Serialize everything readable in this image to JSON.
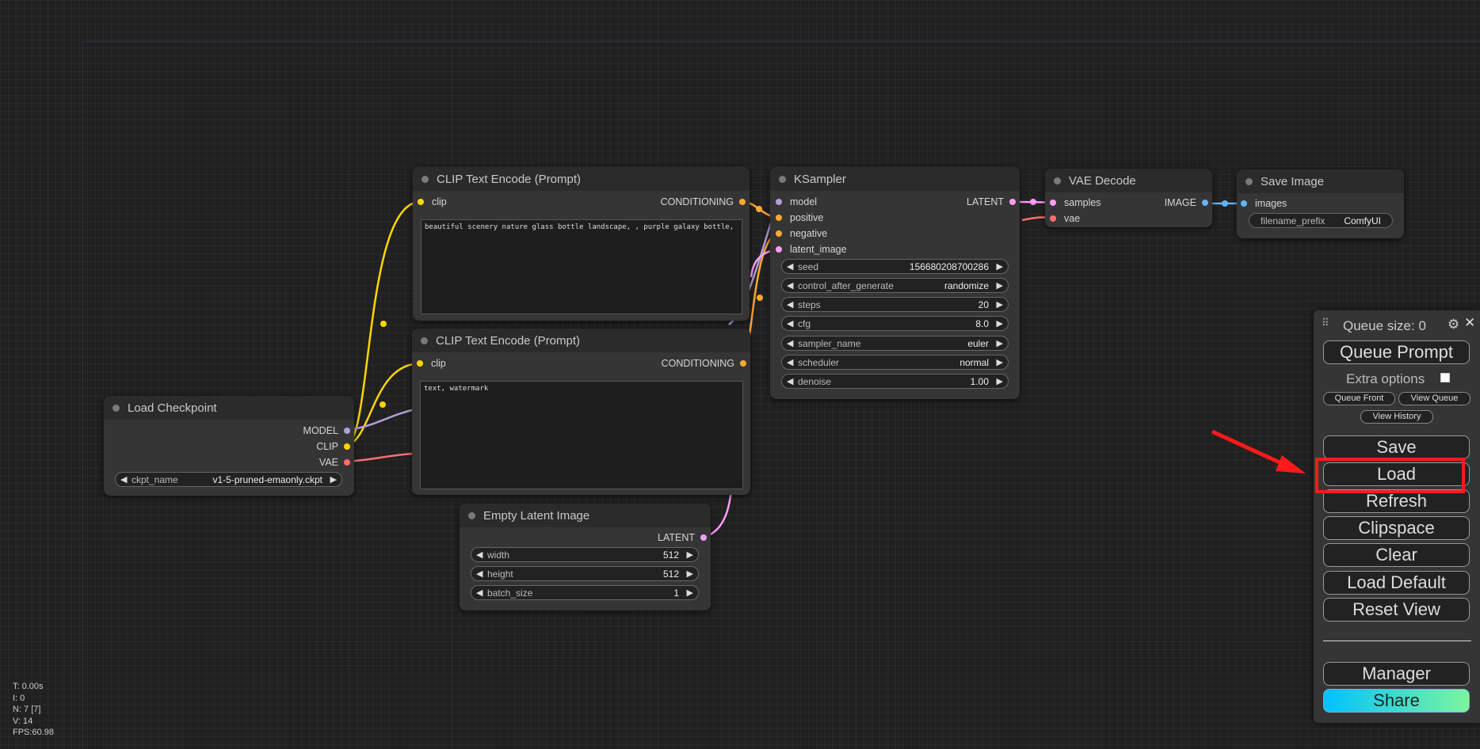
{
  "colors": {
    "model": "#b39ddb",
    "clip": "#ffd500",
    "vae": "#ff6e6e",
    "conditioning": "#ffa931",
    "latent": "#ff9cf9",
    "image": "#64b5f6",
    "annotation": "#ff1a1a"
  },
  "nodes": {
    "clip_pos": {
      "title": "CLIP Text Encode (Prompt)",
      "input_clip": "clip",
      "output": "CONDITIONING",
      "text": "beautiful scenery nature glass bottle landscape, , purple galaxy bottle,"
    },
    "clip_neg": {
      "title": "CLIP Text Encode (Prompt)",
      "input_clip": "clip",
      "output": "CONDITIONING",
      "text": "text, watermark"
    },
    "ksampler": {
      "title": "KSampler",
      "inputs": [
        "model",
        "positive",
        "negative",
        "latent_image"
      ],
      "output": "LATENT",
      "widgets": [
        {
          "name": "seed",
          "value": "156680208700286"
        },
        {
          "name": "control_after_generate",
          "value": "randomize"
        },
        {
          "name": "steps",
          "value": "20"
        },
        {
          "name": "cfg",
          "value": "8.0"
        },
        {
          "name": "sampler_name",
          "value": "euler"
        },
        {
          "name": "scheduler",
          "value": "normal"
        },
        {
          "name": "denoise",
          "value": "1.00"
        }
      ]
    },
    "vae_decode": {
      "title": "VAE Decode",
      "inputs": [
        "samples",
        "vae"
      ],
      "output": "IMAGE"
    },
    "save_image": {
      "title": "Save Image",
      "input": "images",
      "widget": {
        "name": "filename_prefix",
        "value": "ComfyUI"
      }
    },
    "load_checkpoint": {
      "title": "Load Checkpoint",
      "outputs": [
        "MODEL",
        "CLIP",
        "VAE"
      ],
      "widget": {
        "name": "ckpt_name",
        "value": "v1-5-pruned-emaonly.ckpt"
      }
    },
    "empty_latent": {
      "title": "Empty Latent Image",
      "output": "LATENT",
      "widgets": [
        {
          "name": "width",
          "value": "512"
        },
        {
          "name": "height",
          "value": "512"
        },
        {
          "name": "batch_size",
          "value": "1"
        }
      ]
    }
  },
  "queue_panel": {
    "queue_size": "Queue size: 0",
    "queue_prompt": "Queue Prompt",
    "extra_options": "Extra options",
    "queue_front": "Queue Front",
    "view_queue": "View Queue",
    "view_history": "View History",
    "save": "Save",
    "load": "Load",
    "refresh": "Refresh",
    "clipspace": "Clipspace",
    "clear": "Clear",
    "load_default": "Load Default",
    "reset_view": "Reset View",
    "manager": "Manager",
    "share": "Share"
  },
  "stats": [
    "T: 0.00s",
    "I: 0",
    "N: 7 [7]",
    "V: 14",
    "FPS:60.98"
  ]
}
